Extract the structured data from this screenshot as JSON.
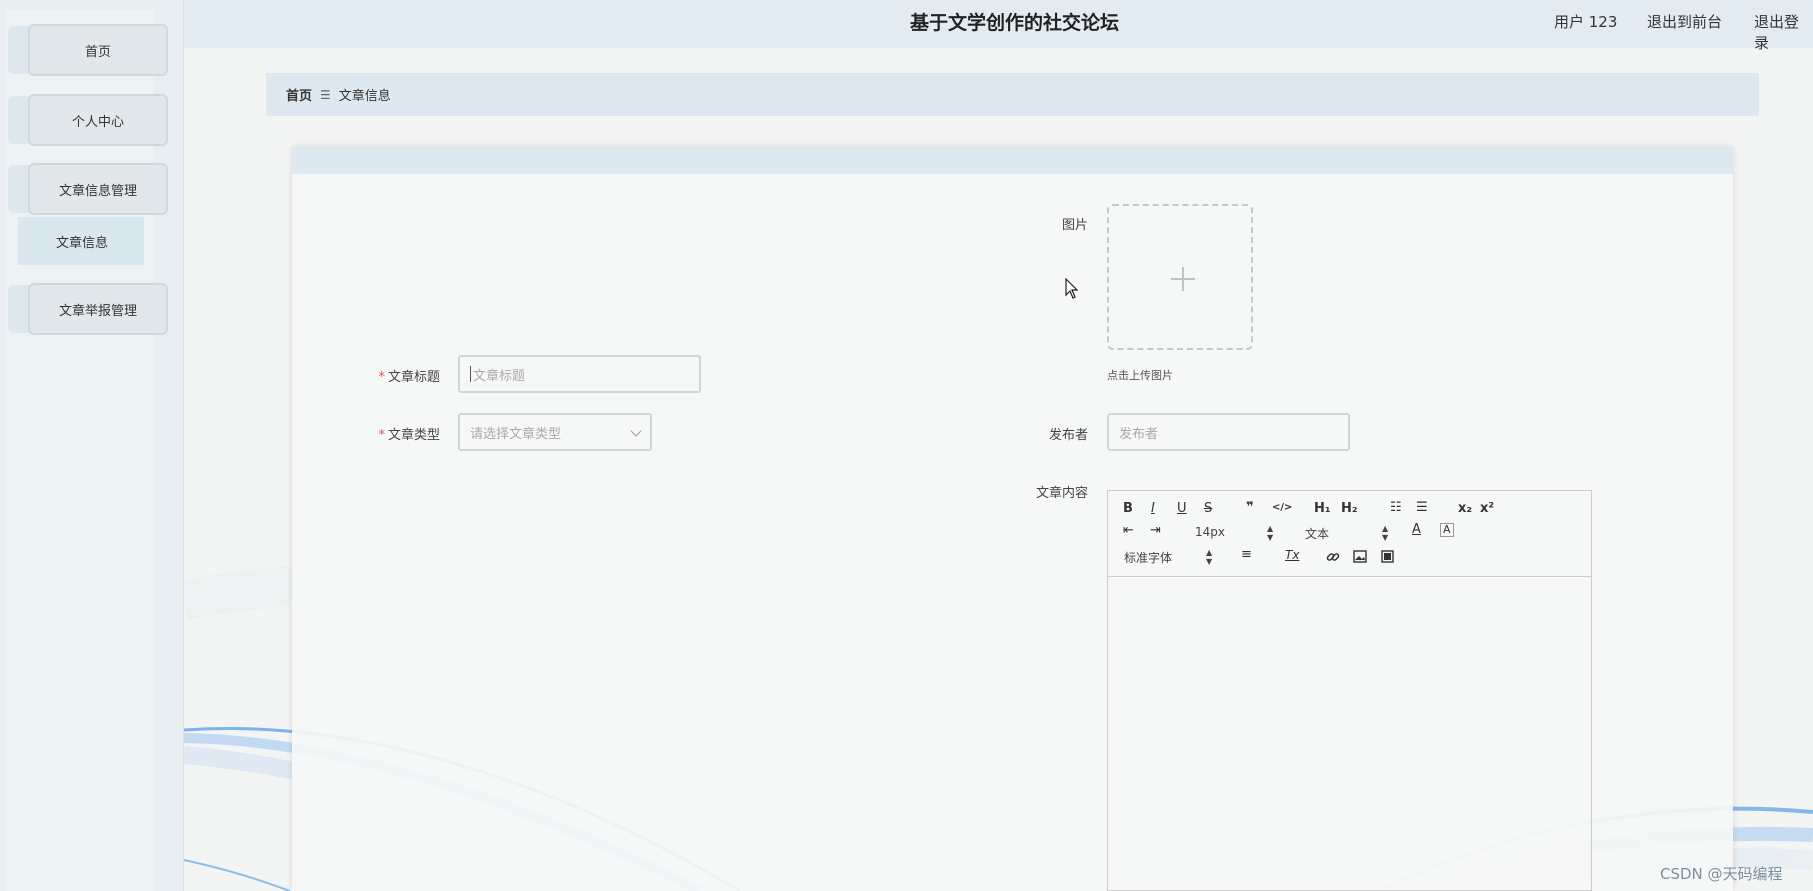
{
  "header": {
    "title": "基于文学创作的社交论坛",
    "user": "用户 123",
    "to_front": "退出到前台",
    "logout": "退出登录"
  },
  "sidebar": {
    "items": [
      {
        "label": "首页"
      },
      {
        "label": "个人中心"
      },
      {
        "label": "文章信息管理"
      },
      {
        "label": "文章举报管理"
      }
    ],
    "submenu": {
      "label": "文章信息"
    }
  },
  "breadcrumb": {
    "home": "首页",
    "separator": "☰",
    "current": "文章信息"
  },
  "form": {
    "title_label": "文章标题",
    "title_placeholder": "文章标题",
    "type_label": "文章类型",
    "type_placeholder": "请选择文章类型",
    "image_label": "图片",
    "upload_hint": "点击上传图片",
    "publisher_label": "发布者",
    "publisher_placeholder": "发布者",
    "content_label": "文章内容",
    "required_mark": "*"
  },
  "editor": {
    "font_size": "14px",
    "header_select": "文本",
    "font_family": "标准字体",
    "buttons": {
      "bold": "B",
      "italic": "I",
      "underline": "U",
      "strike": "S",
      "quote": "❞",
      "code": "</>",
      "h1": "H₁",
      "h2": "H₂",
      "ordered": "☷",
      "bullet": "☰",
      "sub": "x₂",
      "sup": "x²",
      "outdent": "⇤",
      "indent": "⇥",
      "color": "A",
      "background": "A",
      "align": "≡",
      "clean": "Tx",
      "link": "🔗",
      "image": "▣",
      "video": "▤"
    }
  },
  "watermark": "CSDN @天码编程",
  "colors": {
    "sidebar_bg": "#e8eef1",
    "header_bg": "#e2ebf1",
    "required": "#e05050",
    "wave": "#3a8ee6"
  }
}
